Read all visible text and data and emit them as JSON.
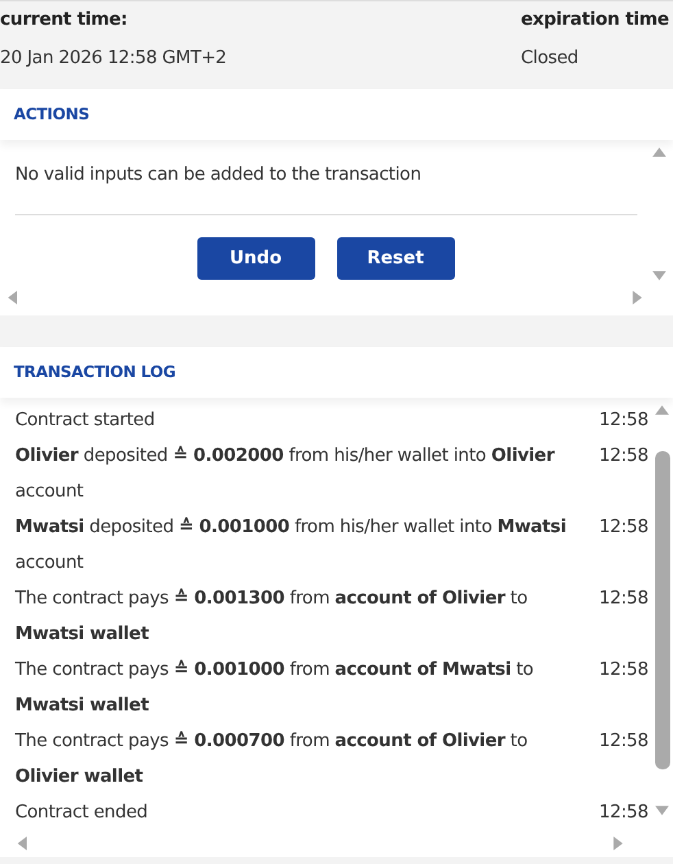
{
  "header": {
    "current_time_label": "current time:",
    "current_time": "20 Jan 2026 12:58 GMT+2",
    "expiration_label": "expiration time",
    "expiration": "Closed"
  },
  "actions": {
    "title": "ACTIONS",
    "message": "No valid inputs can be added to the transaction",
    "buttons": [
      "Undo",
      "Reset"
    ]
  },
  "transaction_log": {
    "title": "TRANSACTION LOG",
    "entries": [
      {
        "message": "Contract started",
        "time": "12:58"
      },
      {
        "message": "**Olivier** deposited **≙ 0.002000** from his/her wallet into **Olivier** account",
        "time": "12:58"
      },
      {
        "message": "**Mwatsi** deposited **≙ 0.001000** from his/her wallet into **Mwatsi** account",
        "time": "12:58"
      },
      {
        "message": "The contract pays **≙ 0.001300** from **account of Olivier** to **Mwatsi wallet**",
        "time": "12:58"
      },
      {
        "message": "The contract pays **≙ 0.001000** from **account of Mwatsi** to **Mwatsi wallet**",
        "time": "12:58"
      },
      {
        "message": "The contract pays **≙ 0.000700** from **account of Olivier** to **Olivier wallet**",
        "time": "12:58"
      },
      {
        "message": "Contract ended",
        "time": "12:58"
      }
    ]
  }
}
